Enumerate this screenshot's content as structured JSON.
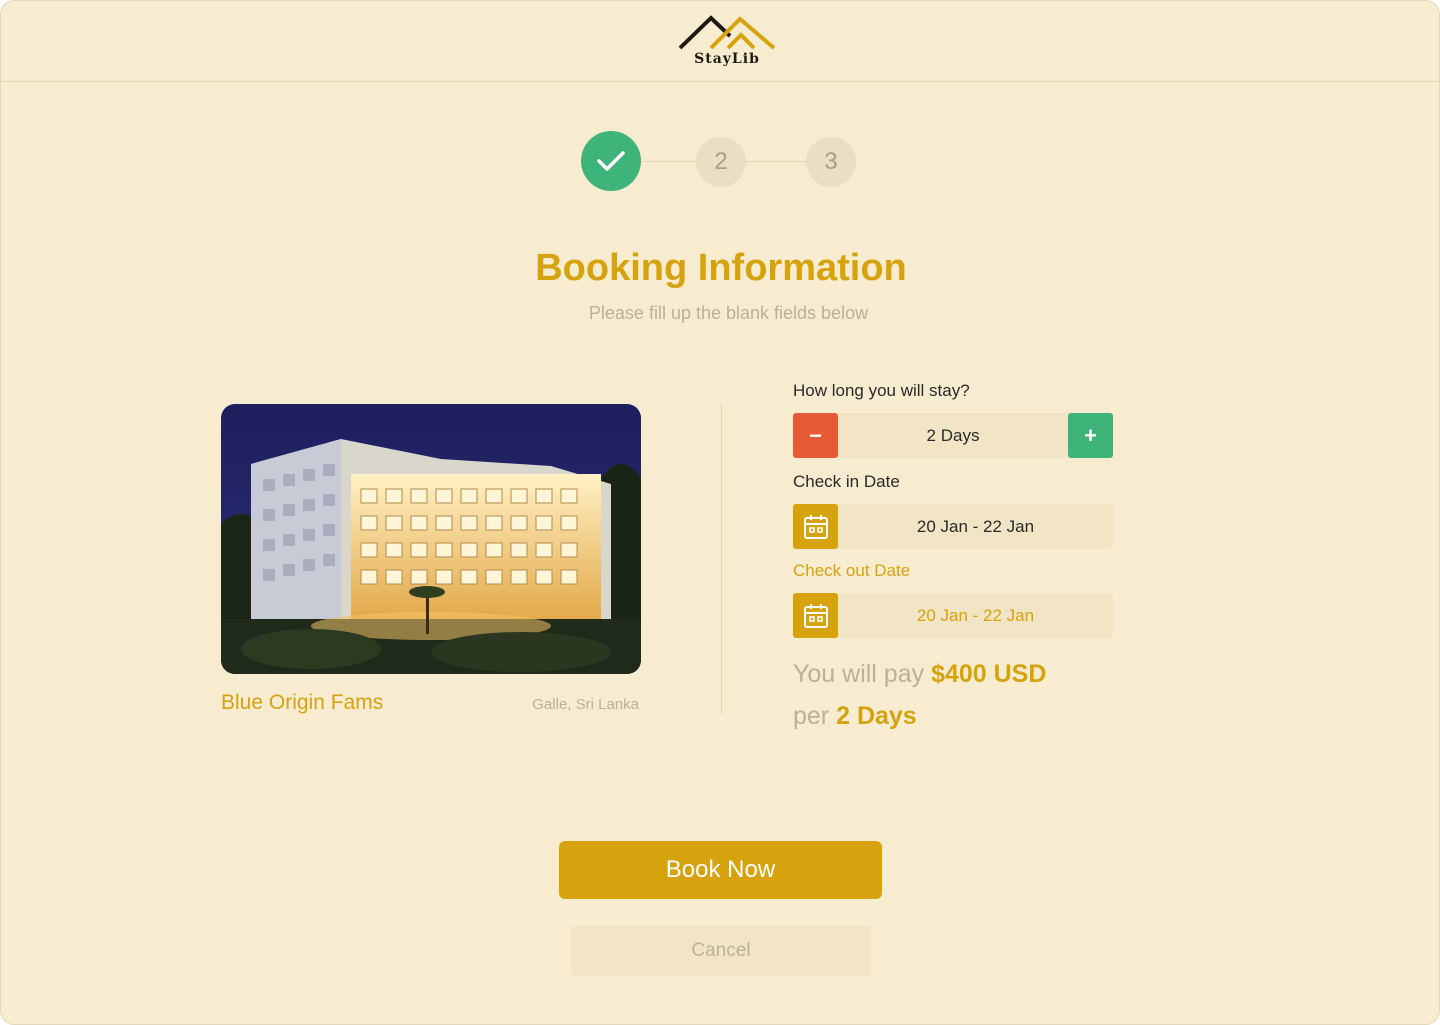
{
  "brand": {
    "name": "StayLib"
  },
  "stepper": {
    "step2": "2",
    "step3": "3"
  },
  "header": {
    "title": "Booking Information",
    "subtitle": "Please fill up the blank fields below"
  },
  "hotel": {
    "name": "Blue Origin Fams",
    "location": "Galle, Sri Lanka"
  },
  "form": {
    "duration_label": "How long you will stay?",
    "duration_value": "2 Days",
    "minus_label": "−",
    "plus_label": "+",
    "checkin_label": "Check in Date",
    "checkin_value": "20 Jan - 22 Jan",
    "checkout_label": "Check out Date",
    "checkout_value": "20 Jan - 22 Jan"
  },
  "payment": {
    "prefix": "You will pay",
    "amount": "$400 USD",
    "per": "per",
    "duration": "2 Days"
  },
  "actions": {
    "book_label": "Book Now",
    "cancel_label": "Cancel"
  },
  "colors": {
    "accent": "#d6a20e",
    "success": "#3fb47a",
    "danger": "#e65a35",
    "background": "#f7ecd0"
  }
}
